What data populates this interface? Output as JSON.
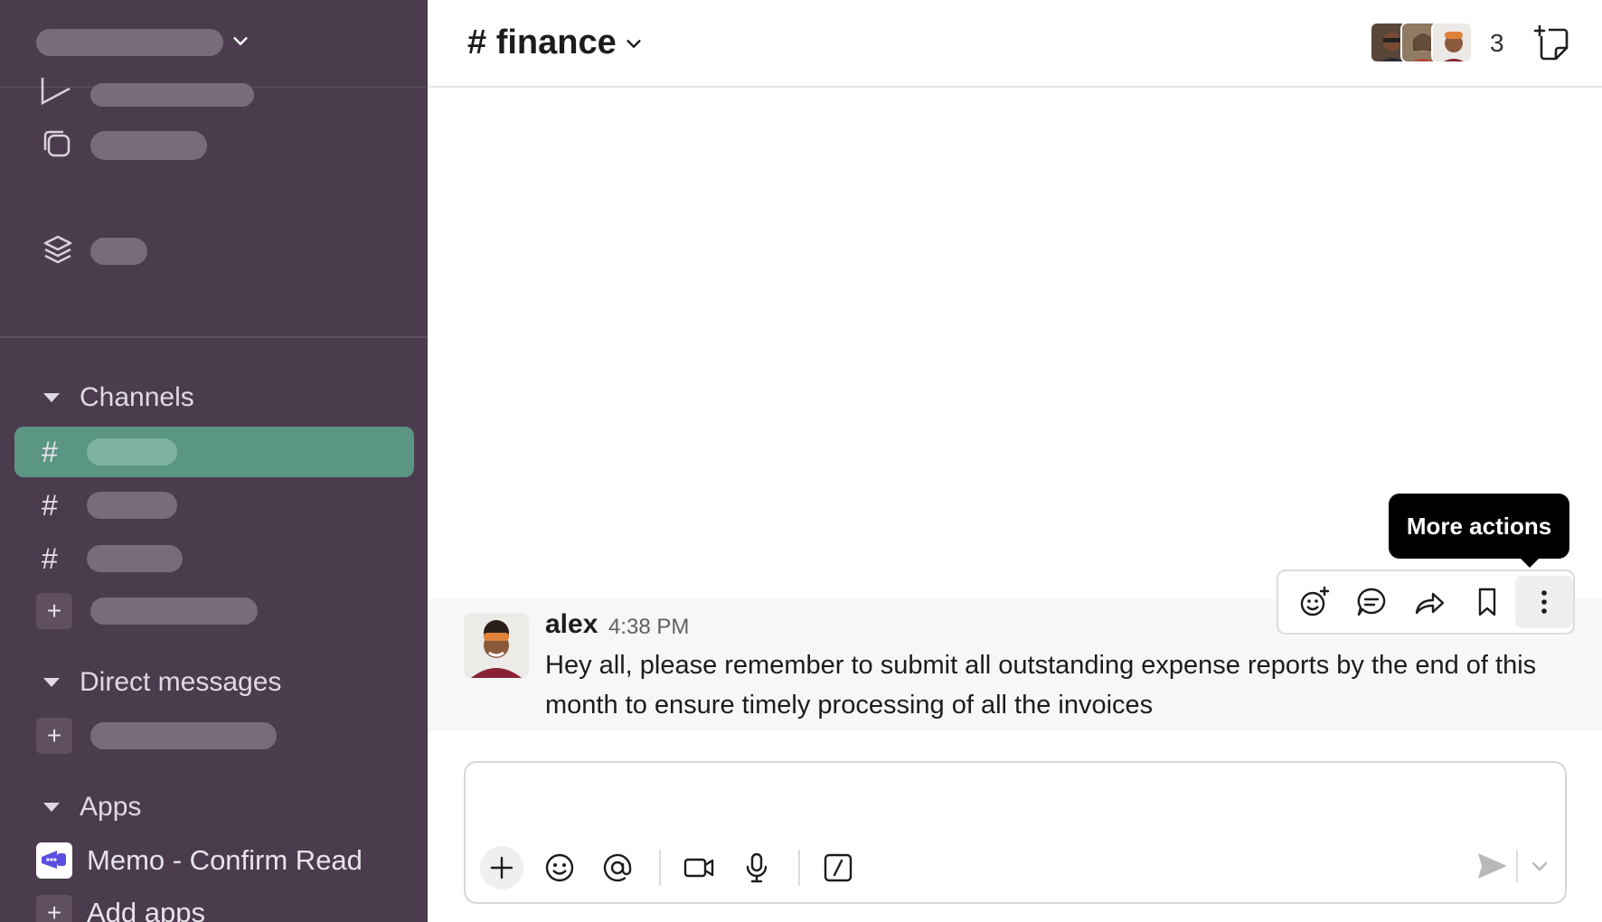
{
  "channel": {
    "name": "# finance",
    "member_count": "3"
  },
  "sidebar": {
    "sections": {
      "channels": "Channels",
      "direct_messages": "Direct messages",
      "apps": "Apps"
    },
    "channel_prefix": "#",
    "add_symbol": "+",
    "apps": [
      {
        "label": "Memo - Confirm Read",
        "icon": "megaphone-app-icon"
      },
      {
        "label": "Add apps",
        "icon": "plus-icon"
      }
    ]
  },
  "message": {
    "author": "alex",
    "time": "4:38 PM",
    "text": "Hey all, please remember to submit all outstanding expense reports by the end of this month to ensure timely processing of all the invoices"
  },
  "tooltip": {
    "label": "More actions"
  },
  "colors": {
    "sidebar_bg": "#4a3c4c",
    "active_channel": "#5b9584",
    "app_icon_accent": "#5b4fe0"
  }
}
